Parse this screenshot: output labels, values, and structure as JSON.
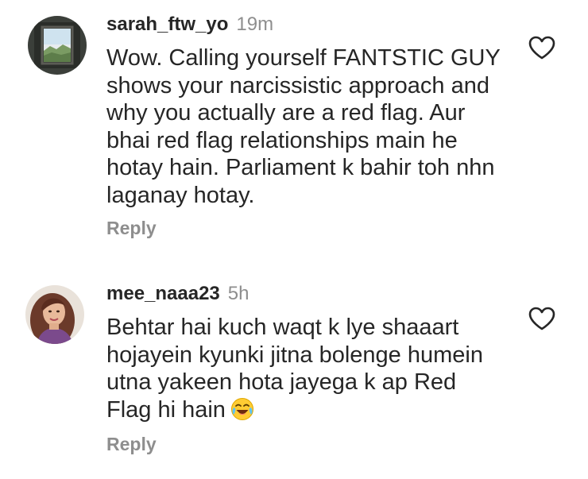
{
  "comments": [
    {
      "username": "sarah_ftw_yo",
      "time": "19m",
      "text": "Wow. Calling yourself FANTSTIC GUY shows your narcissistic approach and why you actually are a red flag. Aur bhai red flag relationships main he hotay hain. Parliament k bahir toh nhn laganay hotay.",
      "reply_label": "Reply",
      "avatar_icon": "landscape-photo-avatar",
      "like_icon": "heart-outline-icon"
    },
    {
      "username": "mee_naaa23",
      "time": "5h",
      "text": "Behtar hai kuch waqt k lye shaaart hojayein kyunki jitna bolenge humein utna yakeen hota jayega k ap Red Flag hi hain",
      "emoji": "face-with-tears-of-joy",
      "reply_label": "Reply",
      "avatar_icon": "woman-portrait-avatar",
      "like_icon": "heart-outline-icon"
    }
  ],
  "colors": {
    "text": "#262626",
    "secondary": "#8e8e8e",
    "background": "#ffffff"
  }
}
